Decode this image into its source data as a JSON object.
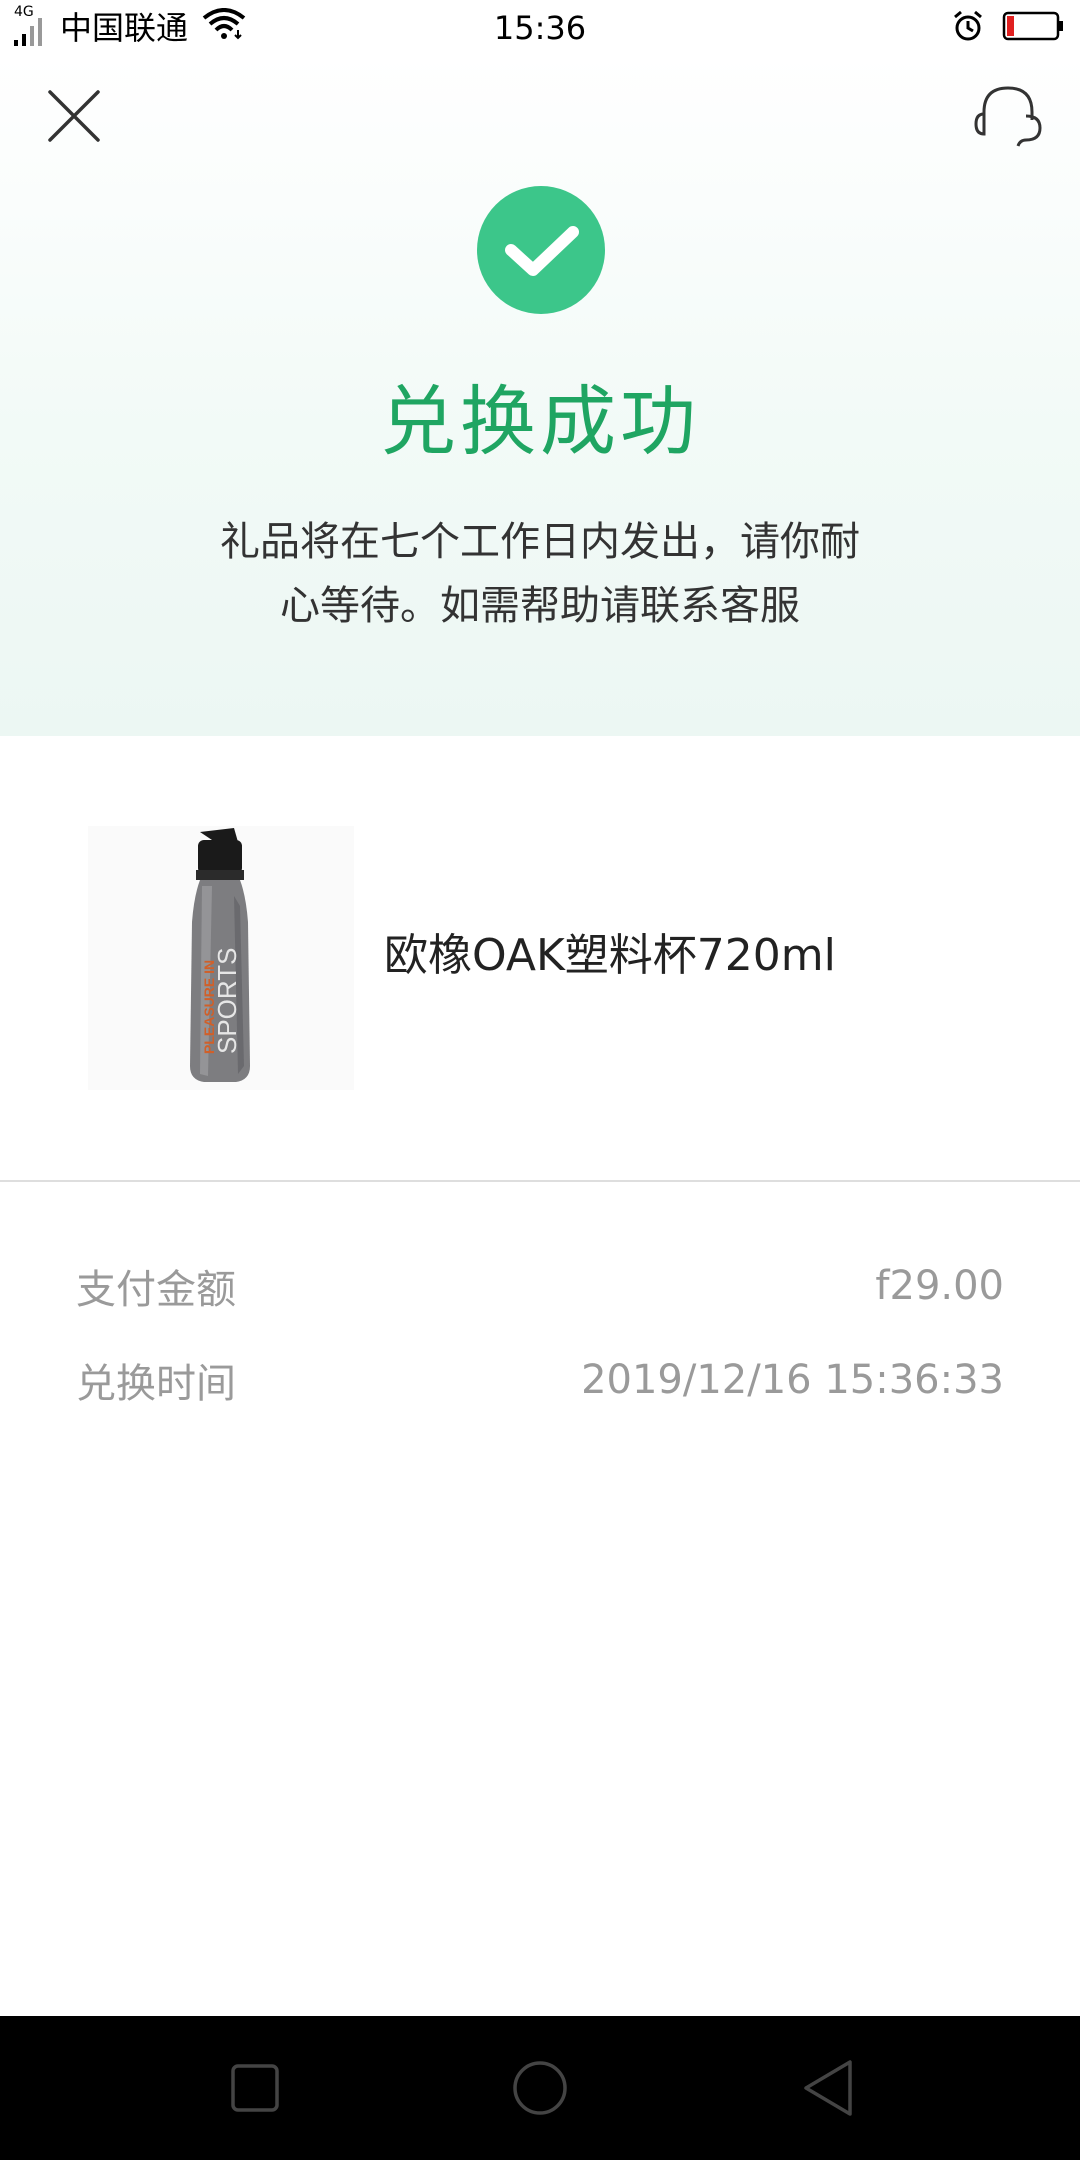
{
  "status_bar": {
    "network": "4G",
    "carrier": "中国联通",
    "time": "15:36",
    "battery_color": "#e02020"
  },
  "header": {
    "close_icon": "close-icon",
    "service_icon": "headset-icon"
  },
  "result": {
    "icon": "check-icon",
    "title": "兑换成功",
    "description": "礼品将在七个工作日内发出，请你耐心等待。如需帮助请联系客服",
    "accent_color": "#1fa562"
  },
  "product": {
    "name": "欧橡OAK塑料杯720ml",
    "image_text_line1": "PLEASURE IN",
    "image_text_line2": "SPORTS"
  },
  "details": {
    "amount_label": "支付金额",
    "amount_value": "f29.00",
    "time_label": "兑换时间",
    "time_value": "2019/12/16 15:36:33"
  },
  "nav": {
    "recent": "square-icon",
    "home": "circle-icon",
    "back": "triangle-back-icon"
  }
}
